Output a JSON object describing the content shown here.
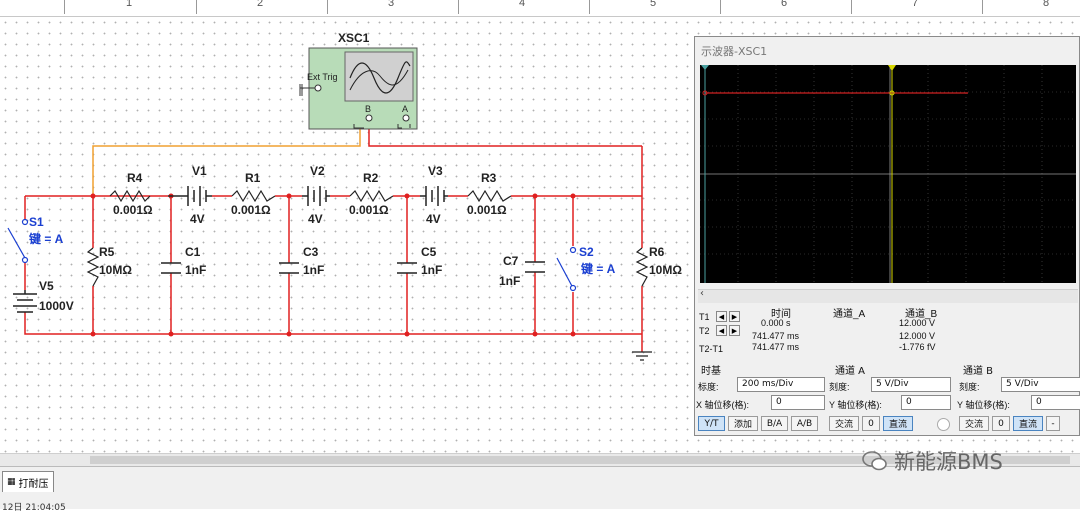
{
  "ruler": {
    "numbers": [
      "1",
      "2",
      "3",
      "4",
      "5",
      "6",
      "7",
      "8"
    ]
  },
  "instrument": {
    "name": "XSC1",
    "ext_trig": "Ext Trig",
    "port_b": "B",
    "port_a": "A"
  },
  "components": {
    "s1": {
      "name": "S1",
      "key": "键 = A"
    },
    "s2": {
      "name": "S2",
      "key": "键 = A"
    },
    "v5": {
      "name": "V5",
      "value": "1000V"
    },
    "r4": {
      "name": "R4",
      "value": "0.001Ω"
    },
    "r1": {
      "name": "R1",
      "value": "0.001Ω"
    },
    "r2": {
      "name": "R2",
      "value": "0.001Ω"
    },
    "r3": {
      "name": "R3",
      "value": "0.001Ω"
    },
    "v1": {
      "name": "V1",
      "value": "4V"
    },
    "v2": {
      "name": "V2",
      "value": "4V"
    },
    "v3": {
      "name": "V3",
      "value": "4V"
    },
    "r5": {
      "name": "R5",
      "value": "10MΩ"
    },
    "r6": {
      "name": "R6",
      "value": "10MΩ"
    },
    "c1": {
      "name": "C1",
      "value": "1nF"
    },
    "c3": {
      "name": "C3",
      "value": "1nF"
    },
    "c5": {
      "name": "C5",
      "value": "1nF"
    },
    "c7": {
      "name": "C7",
      "value": "1nF"
    }
  },
  "scope": {
    "title": "示波器-XSC1",
    "readout": {
      "headers": {
        "time": "时间",
        "ch_a": "通道_A",
        "ch_b": "通道_B"
      },
      "rows": [
        {
          "label": "T1",
          "time": "0.000 s",
          "ch_a": "",
          "ch_b": "12.000 V"
        },
        {
          "label": "T2",
          "time": "741.477 ms",
          "ch_a": "",
          "ch_b": "12.000 V"
        },
        {
          "label": "T2-T1",
          "time": "741.477 ms",
          "ch_a": "",
          "ch_b": "-1.776 fV"
        }
      ]
    },
    "timebase": {
      "title": "时基",
      "scale_label": "标度:",
      "scale_value": "200 ms/Div",
      "xpos_label": "X 轴位移(格):",
      "xpos_value": "0",
      "buttons": [
        "Y/T",
        "添加",
        "B/A",
        "A/B"
      ]
    },
    "channel_a": {
      "title": "通道 A",
      "scale_label": "刻度:",
      "scale_value": "5 V/Div",
      "ypos_label": "Y 轴位移(格):",
      "ypos_value": "0",
      "buttons": [
        "交流",
        "0",
        "直流"
      ]
    },
    "channel_b": {
      "title": "通道 B",
      "scale_label": "刻度:",
      "scale_value": "5 V/Div",
      "ypos_label": "Y 轴位移(格):",
      "ypos_value": "0",
      "buttons": [
        "交流",
        "0",
        "直流",
        "-"
      ]
    }
  },
  "tab": {
    "label": "打耐压"
  },
  "status": {
    "text": "12日 21:04:05"
  },
  "watermark": {
    "text": "新能源BMS"
  },
  "colors": {
    "wire": "#e02020",
    "probe_wire": "#f0a030",
    "trace_b": "#d02020",
    "cursor": "#d8d800",
    "screen": "#000000"
  }
}
